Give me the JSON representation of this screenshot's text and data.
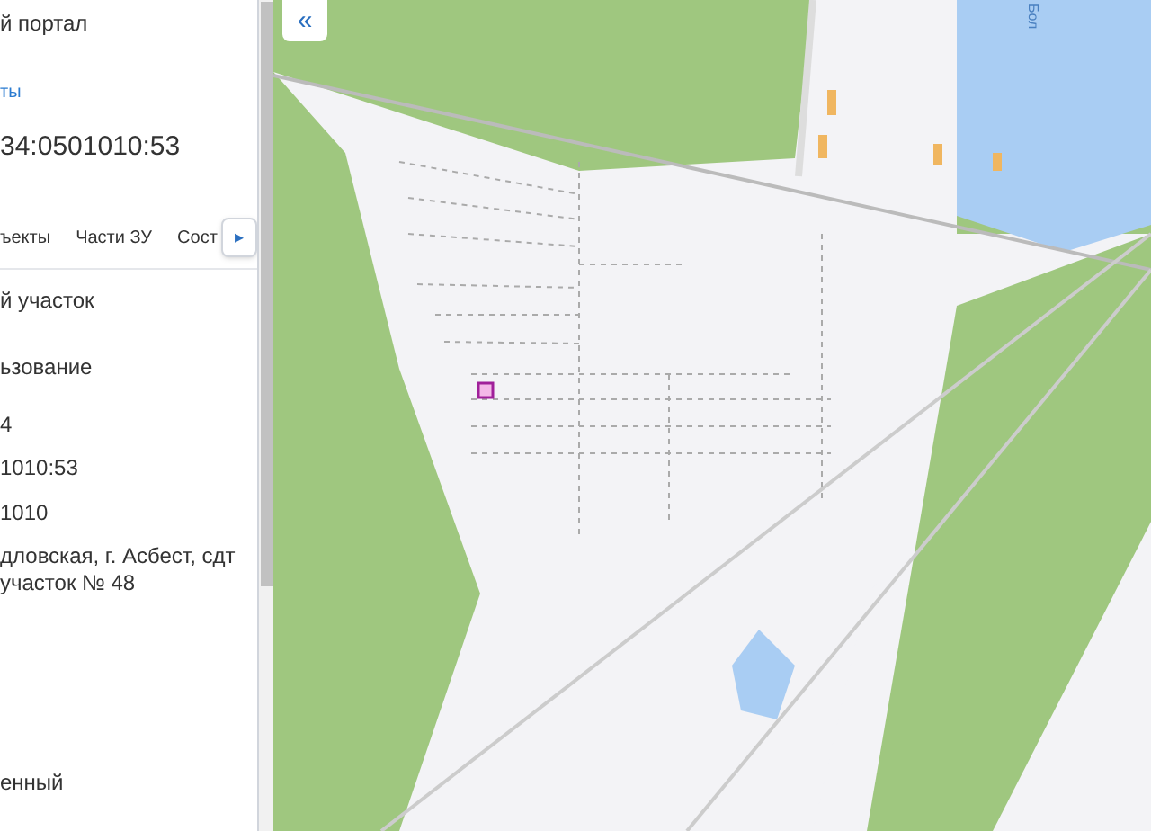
{
  "panel": {
    "portal_title": "й портал",
    "link": "ты",
    "cadastral_number": "34:0501010:53",
    "tabs": [
      {
        "label": "ъекты"
      },
      {
        "label": "Части ЗУ"
      },
      {
        "label": "Сост"
      }
    ],
    "tab_scroll": "▸",
    "fields": [
      {
        "lines": [
          "й участок"
        ]
      },
      {
        "lines": [
          "ьзование"
        ]
      },
      {
        "lines": [
          "4"
        ]
      },
      {
        "lines": [
          "1010:53"
        ]
      },
      {
        "lines": [
          "1010"
        ]
      },
      {
        "lines": [
          "дловская, г. Асбест, сдт",
          "участок № 48"
        ]
      },
      {
        "lines": [
          "енный"
        ]
      }
    ]
  },
  "map": {
    "collapse_button": "«",
    "lake_label": "Бол"
  }
}
